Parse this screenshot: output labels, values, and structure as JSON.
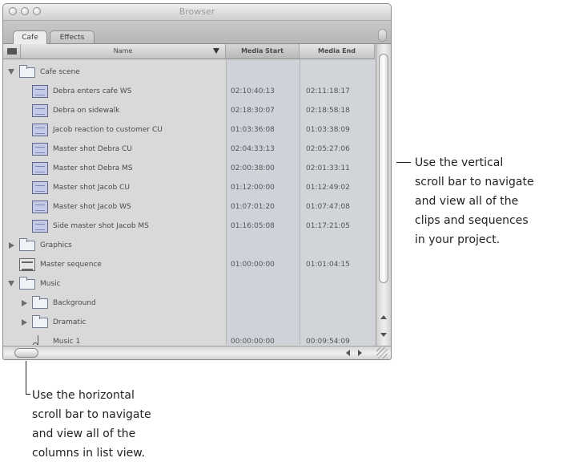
{
  "window": {
    "title": "Browser",
    "tabs": [
      "Cafe",
      "Effects"
    ]
  },
  "columns": {
    "name": "Name",
    "media_start": "Media Start",
    "media_end": "Media End"
  },
  "rows": [
    {
      "name": "Cafe scene",
      "type": "folder",
      "expanded": true,
      "indent": 0,
      "start": "",
      "end": ""
    },
    {
      "name": "Debra enters cafe WS",
      "type": "clip",
      "indent": 1,
      "start": "02:10:40:13",
      "end": "02:11:18:17"
    },
    {
      "name": "Debra on sidewalk",
      "type": "clip",
      "indent": 1,
      "start": "02:18:30:07",
      "end": "02:18:58:18"
    },
    {
      "name": "Jacob reaction to customer CU",
      "type": "clip",
      "indent": 1,
      "start": "01:03:36:08",
      "end": "01:03:38:09"
    },
    {
      "name": "Master shot Debra CU",
      "type": "clip",
      "indent": 1,
      "start": "02:04:33:13",
      "end": "02:05:27:06"
    },
    {
      "name": "Master shot Debra MS",
      "type": "clip",
      "indent": 1,
      "start": "02:00:38:00",
      "end": "02:01:33:11"
    },
    {
      "name": "Master shot Jacob CU",
      "type": "clip",
      "indent": 1,
      "start": "01:12:00:00",
      "end": "01:12:49:02"
    },
    {
      "name": "Master shot Jacob WS",
      "type": "clip",
      "indent": 1,
      "start": "01:07:01:20",
      "end": "01:07:47:08"
    },
    {
      "name": "Side master shot Jacob MS",
      "type": "clip",
      "indent": 1,
      "start": "01:16:05:08",
      "end": "01:17:21:05"
    },
    {
      "name": "Graphics",
      "type": "folder",
      "expanded": false,
      "indent": 0,
      "start": "",
      "end": ""
    },
    {
      "name": "Master sequence",
      "type": "sequence",
      "indent": 0,
      "start": "01:00:00:00",
      "end": "01:01:04:15"
    },
    {
      "name": "Music",
      "type": "folder",
      "expanded": true,
      "indent": 0,
      "start": "",
      "end": ""
    },
    {
      "name": "Background",
      "type": "folder",
      "expanded": false,
      "indent": 1,
      "start": "",
      "end": ""
    },
    {
      "name": "Dramatic",
      "type": "folder",
      "expanded": false,
      "indent": 1,
      "start": "",
      "end": ""
    },
    {
      "name": "Music 1",
      "type": "audio",
      "indent": 1,
      "start": "00:00:00:00",
      "end": "00:09:54:09"
    }
  ],
  "callouts": {
    "vertical": [
      "Use the vertical",
      "scroll bar to navigate",
      "and view all of the",
      "clips and sequences",
      "in your project."
    ],
    "horizontal": [
      "Use the horizontal",
      "scroll bar to navigate",
      "and view all of the",
      "columns in list view."
    ]
  }
}
